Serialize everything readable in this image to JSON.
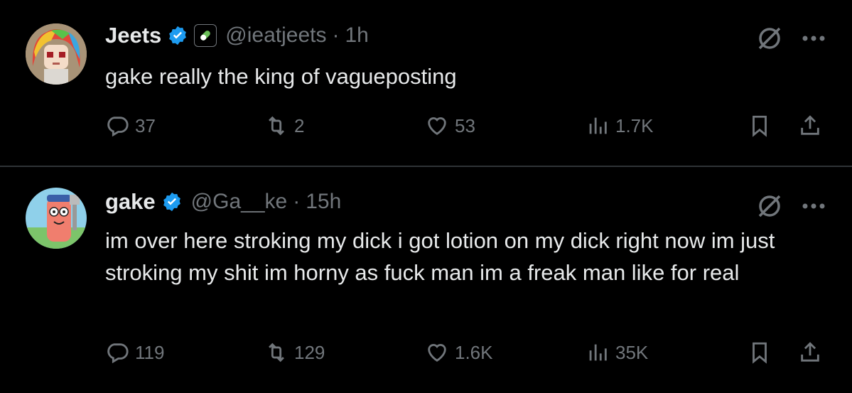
{
  "tweets": [
    {
      "name": "Jeets",
      "handle": "@ieatjeets",
      "separator": "·",
      "time": "1h",
      "text": "gake really the king of vagueposting",
      "replies": "37",
      "retweets": "2",
      "likes": "53",
      "views": "1.7K",
      "has_label_badge": true,
      "avatar": "anime-girl-rainbow-hair-avatar"
    },
    {
      "name": "gake",
      "handle": "@Ga__ke",
      "separator": "·",
      "time": "15h",
      "text": "im over here stroking my dick i got lotion on my dick right now im just stroking my shit im horny as fuck man im a freak man like for real",
      "replies": "119",
      "retweets": "129",
      "likes": "1.6K",
      "views": "35K",
      "has_label_badge": false,
      "avatar": "cartoon-character-with-spatula-avatar"
    }
  ],
  "colors": {
    "background": "#000000",
    "text": "#e7e9ea",
    "muted": "#71767b",
    "verified": "#1d9bf0",
    "divider": "#2f3336"
  }
}
